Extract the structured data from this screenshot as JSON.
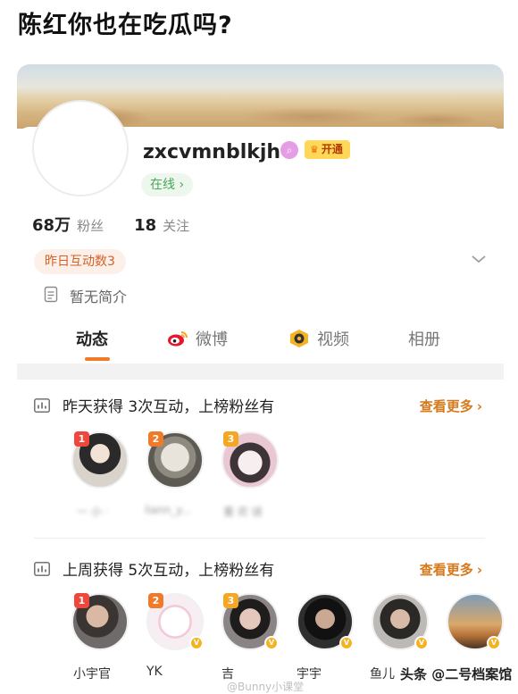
{
  "headline": "陈红你也在吃瓜吗?",
  "profile": {
    "username": "zxcvmnblkjh",
    "vip_label": "开通",
    "online_status": "在线 ›",
    "followers_count": "68万",
    "followers_label": "粉丝",
    "following_count": "18",
    "following_label": "关注",
    "interaction_badge": "昨日互动数3",
    "bio": "暂无简介"
  },
  "tabs": [
    {
      "label": "动态"
    },
    {
      "label": "微博"
    },
    {
      "label": "视频"
    },
    {
      "label": "相册"
    }
  ],
  "sections": [
    {
      "title": "昨天获得 3次互动，上榜粉丝有",
      "see_more": "查看更多",
      "fans": [
        {
          "rank": "1",
          "name": "一 小 ·"
        },
        {
          "rank": "2",
          "name": "liann_y..."
        },
        {
          "rank": "3",
          "name": "重 欢 谜"
        }
      ]
    },
    {
      "title": "上周获得 5次互动，上榜粉丝有",
      "see_more": "查看更多",
      "fans": [
        {
          "rank": "1",
          "name": "小宇官"
        },
        {
          "rank": "2",
          "name": "YK"
        },
        {
          "rank": "3",
          "name": "吉"
        },
        {
          "rank": "",
          "name": "宇宇"
        },
        {
          "rank": "",
          "name": "鱼儿"
        },
        {
          "rank": "",
          "name": ""
        }
      ]
    }
  ],
  "footer": {
    "watermark": "@Bunny小课堂",
    "source": "头条 @二号档案馆"
  },
  "colors": {
    "accent": "#f07a27",
    "rank1": "#f0463c",
    "rank2": "#f07a2a",
    "rank3": "#f5a623",
    "online_green": "#49a55a"
  }
}
